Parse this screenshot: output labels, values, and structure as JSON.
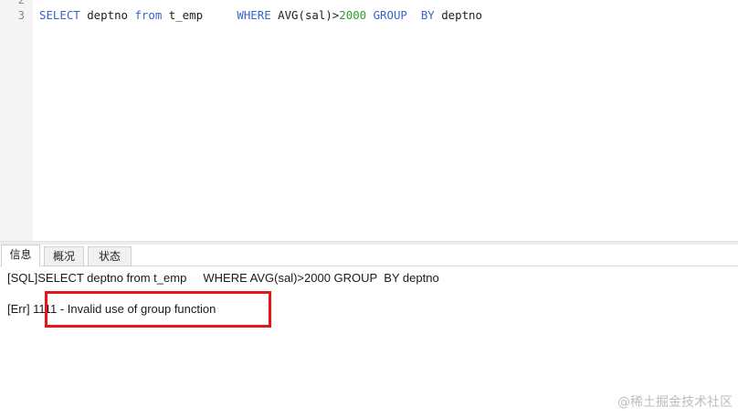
{
  "editor": {
    "lines": [
      {
        "number": "2",
        "code": ""
      },
      {
        "number": "3",
        "tokens": {
          "t1": "SELECT",
          "t2": " deptno ",
          "t3": "from",
          "t4": " t_emp     ",
          "t5": "WHERE",
          "t6": " AVG(sal)>",
          "t7": "2000",
          "t8": " ",
          "t9": "GROUP",
          "t10": "  ",
          "t11": "BY",
          "t12": " deptno"
        }
      }
    ],
    "colors": {
      "keyword": "#3a63c8",
      "number": "#2e9b2e",
      "text": "#202020",
      "line_number": "#8a8a8a"
    }
  },
  "tabs": [
    {
      "label": "信息",
      "active": true
    },
    {
      "label": "概况",
      "active": false
    },
    {
      "label": "状态",
      "active": false
    }
  ],
  "messages": {
    "sql": "[SQL]SELECT deptno from t_emp     WHERE AVG(sal)>2000 GROUP  BY deptno",
    "error": "[Err] 1111 - Invalid use of group function"
  },
  "annotation": {
    "box_color": "#e8141c"
  },
  "watermark": "@稀土掘金技术社区"
}
